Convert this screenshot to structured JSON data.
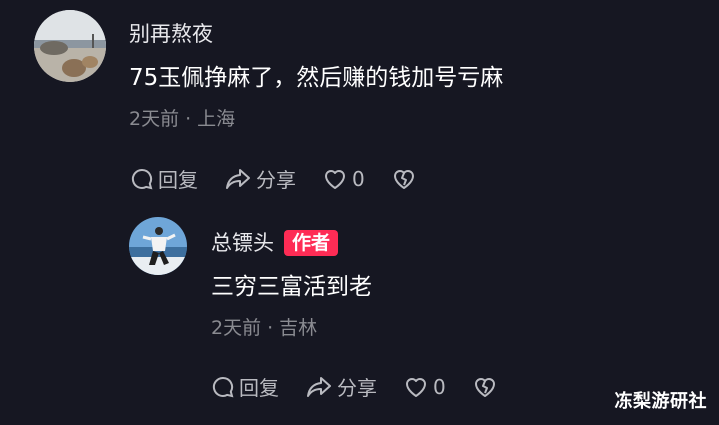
{
  "comments": [
    {
      "username": "别再熬夜",
      "content": "75玉佩挣麻了，然后赚的钱加号亏麻",
      "time": "2天前",
      "location": "上海",
      "reply_label": "回复",
      "share_label": "分享",
      "likes": "0"
    },
    {
      "username": "总镖头",
      "badge": "作者",
      "content": "三穷三富活到老",
      "time": "2天前",
      "location": "吉林",
      "reply_label": "回复",
      "share_label": "分享",
      "likes": "0"
    }
  ],
  "separator": "·",
  "watermark": "冻梨游研社",
  "icons": [
    "comment-bubble-icon",
    "share-arrow-icon",
    "heart-icon",
    "broken-heart-icon"
  ],
  "colors": {
    "background": "#161722",
    "badge": "#fe2c55",
    "meta": "#8a8b91"
  }
}
